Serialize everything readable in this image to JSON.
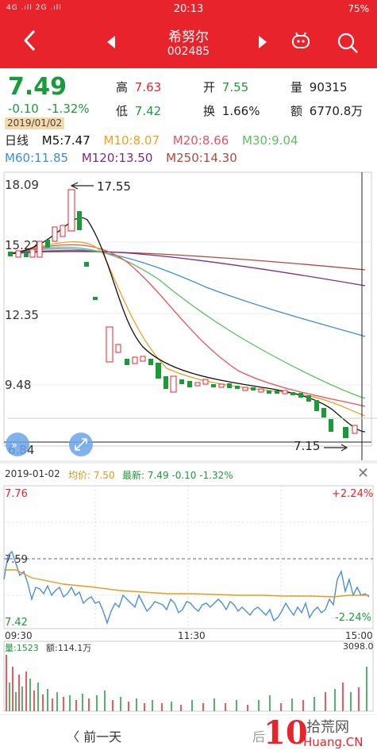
{
  "status": {
    "signal": "4G .ıll 2G .ıll",
    "time": "20:13",
    "battery": "75%"
  },
  "nav": {
    "name": "希努尔",
    "code": "002485"
  },
  "quote": {
    "price": "7.49",
    "change": "-0.10",
    "change_pct": "-1.32%",
    "high_label": "高",
    "high": "7.63",
    "low_label": "低",
    "low": "7.42",
    "open_label": "开",
    "open": "7.55",
    "turnover_label": "换",
    "turnover": "1.66%",
    "volume_label": "量",
    "volume": "90315",
    "amount_label": "额",
    "amount": "6770.8万",
    "date": "2019/01/02"
  },
  "ma": {
    "daily_label": "日线",
    "ma5": "M5:7.47",
    "ma10": "M10:8.07",
    "ma20": "M20:8.66",
    "ma30": "M30:9.04",
    "ma60": "M60:11.85",
    "ma120": "M120:13.50",
    "ma250": "M250:14.30"
  },
  "kline": {
    "y_labels": [
      "18.09",
      "15.22",
      "12.35",
      "9.48",
      "6.84"
    ],
    "high_annotation": "17.55",
    "low_annotation": "7.15"
  },
  "intraday": {
    "date": "2019-01-02",
    "avg_label": "均价: 7.50",
    "latest_label": "最新: 7.49 -0.10 -1.32%",
    "y_top": "7.76",
    "y_mid": "7.59",
    "y_bottom": "7.42",
    "pct_top": "+2.24%",
    "pct_bottom": "-2.24%",
    "times": [
      "09:30",
      "11:30",
      "15:00"
    ],
    "vol_label": "量:1523",
    "amt_label": "额:114.1万",
    "vol_max": "3098.0"
  },
  "footer": {
    "prev_day": "〈 前一天",
    "next_day": "后"
  },
  "watermark": {
    "num": "10",
    "site_cn": "拾荒网",
    "site": "Huang.CN"
  },
  "colors": {
    "red": "#e8232c",
    "green": "#1a9b3a",
    "orange": "#e89a1c",
    "ma5": "#111111",
    "ma10": "#f0a020",
    "ma20": "#e8535e",
    "ma30": "#5cc060",
    "ma60": "#3b8fd8",
    "ma120": "#7a2a8a",
    "ma250": "#b04a3a"
  }
}
